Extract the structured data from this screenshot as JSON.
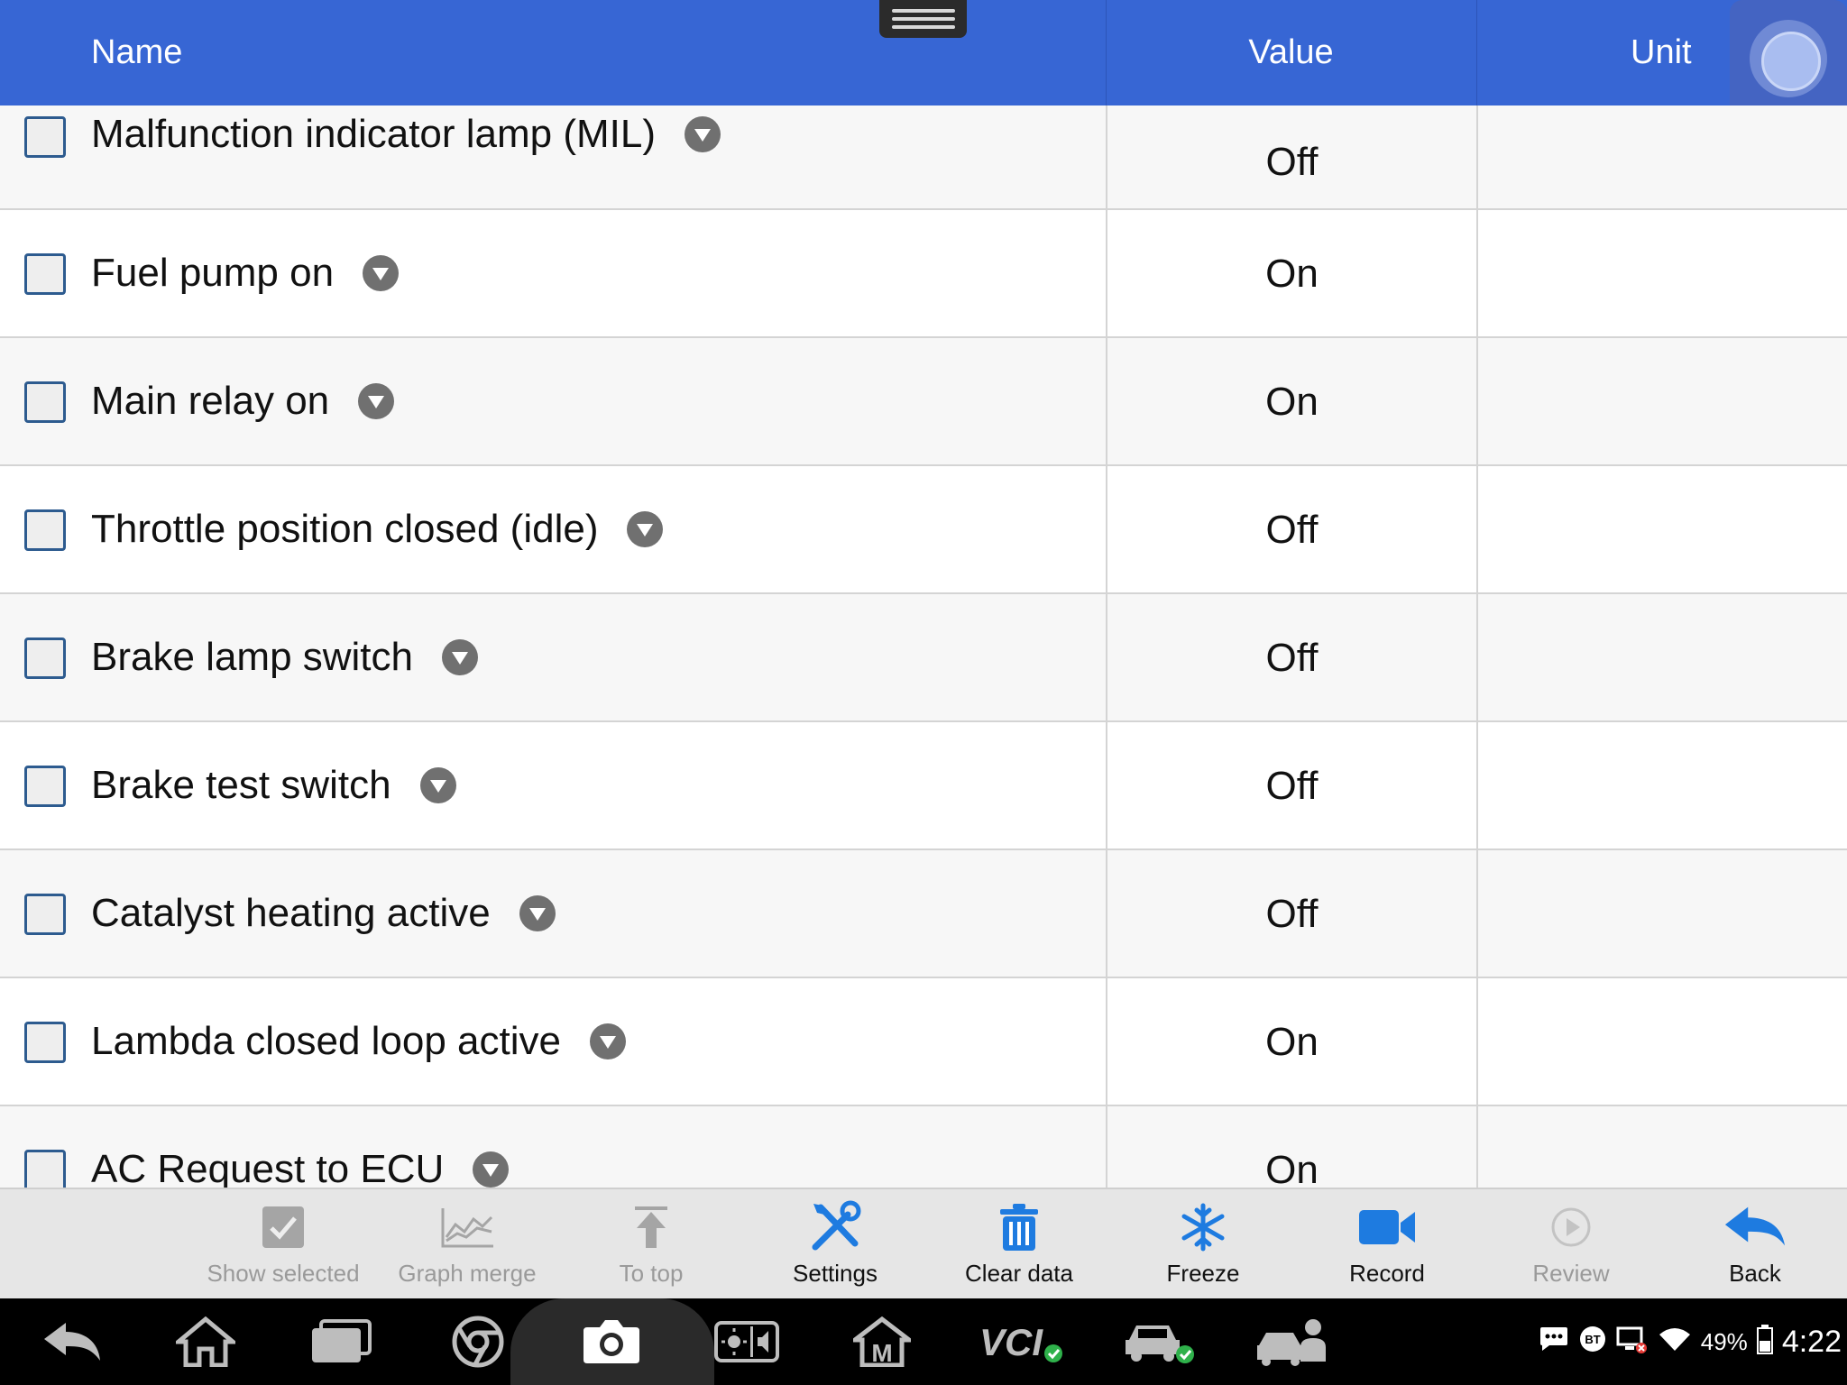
{
  "header": {
    "name": "Name",
    "value": "Value",
    "unit": "Unit"
  },
  "rows": [
    {
      "name": "Malfunction indicator lamp (MIL)",
      "value": "Off",
      "unit": ""
    },
    {
      "name": "Fuel pump on",
      "value": "On",
      "unit": ""
    },
    {
      "name": "Main relay on",
      "value": "On",
      "unit": ""
    },
    {
      "name": "Throttle position closed (idle)",
      "value": "Off",
      "unit": ""
    },
    {
      "name": "Brake lamp switch",
      "value": "Off",
      "unit": ""
    },
    {
      "name": "Brake test switch",
      "value": "Off",
      "unit": ""
    },
    {
      "name": "Catalyst heating active",
      "value": "Off",
      "unit": ""
    },
    {
      "name": "Lambda closed loop active",
      "value": "On",
      "unit": ""
    },
    {
      "name": "AC Request to ECU",
      "value": "On",
      "unit": ""
    }
  ],
  "toolbar": {
    "show_selected": "Show selected",
    "graph_merge": "Graph merge",
    "to_top": "To top",
    "settings": "Settings",
    "clear_data": "Clear data",
    "freeze": "Freeze",
    "record": "Record",
    "review": "Review",
    "back": "Back"
  },
  "status": {
    "battery": "49%",
    "time": "4:22",
    "bt": "BT"
  },
  "colors": {
    "header": "#3766d4",
    "accent": "#1e7be0",
    "checkbox_border": "#2d5b8f"
  }
}
